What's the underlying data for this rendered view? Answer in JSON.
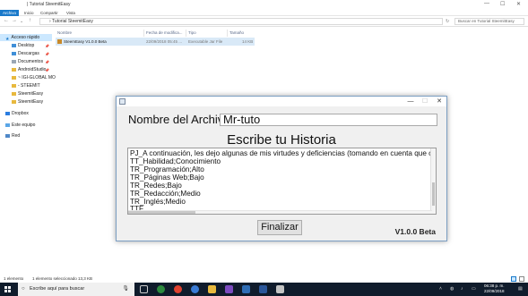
{
  "explorer": {
    "title": "Tutorial SteemitEasy",
    "ribbon_tabs": [
      "Archivo",
      "Inicio",
      "Compartir",
      "Vista"
    ],
    "address_path": "Tutorial SteemitEasy",
    "search_placeholder": "Buscar en Tutorial SteemitEasy",
    "sidebar": [
      {
        "label": "Acceso rápido",
        "pinned": false
      },
      {
        "label": "Desktop",
        "pinned": true
      },
      {
        "label": "Descargas",
        "pinned": true
      },
      {
        "label": "Documentos",
        "pinned": true
      },
      {
        "label": "AndroidStudio",
        "pinned": true
      },
      {
        "label": "~ IGI-GLOBAL MO",
        "pinned": false
      },
      {
        "label": "- STEEMIT",
        "pinned": false
      },
      {
        "label": "SteemitEasy",
        "pinned": false
      },
      {
        "label": "SteemitEasy",
        "pinned": false
      },
      {
        "label": "Dropbox",
        "pinned": false
      },
      {
        "label": "Este equipo",
        "pinned": false
      },
      {
        "label": "Red",
        "pinned": false
      }
    ],
    "columns": [
      "Nombre",
      "Fecha de modifica...",
      "Tipo",
      "Tamaño"
    ],
    "file": {
      "name": "SteemEasy V1.0.0 Beta",
      "date": "22/09/2018 05:45 ...",
      "type": "Executable Jar File",
      "size": "14 KB"
    },
    "status": {
      "count": "1 elemento",
      "selected": "1 elemento seleccionado  13,3 KB"
    }
  },
  "taskbar": {
    "search_placeholder": "Escribe aquí para buscar",
    "time": "06:38 p. m.",
    "date": "22/09/2018"
  },
  "app": {
    "name_label": "Nombre del Archivo:",
    "name_value": "Mr-tuto",
    "heading": "Escribe tu Historia",
    "story_lines": [
      "PJ_A continuación, les dejo algunas de mis virtudes y deficiencias (tomando en cuenta que con \"alto\" n",
      "TT_Habilidad;Conocimiento",
      "TR_Programación;Alto",
      "TR_Páginas Web;Bajo",
      "TR_Redes;Bajo",
      "TR_Redacción;Medio",
      "TR_Inglés;Medio",
      "TTF"
    ],
    "finish_button": "Finalizar",
    "version": "V1.0.0 Beta",
    "close_glyph": "✕",
    "minimize_glyph": "—",
    "maximize_glyph": "☐"
  }
}
